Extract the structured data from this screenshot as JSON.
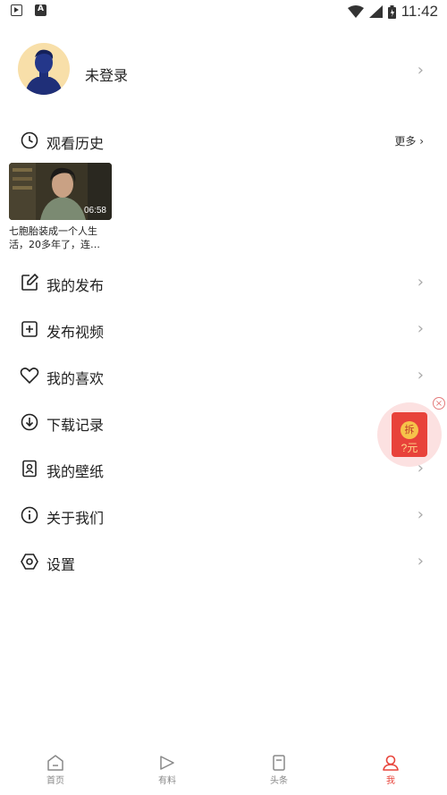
{
  "status_bar": {
    "time": "11:42"
  },
  "profile": {
    "name": "未登录"
  },
  "history": {
    "title": "观看历史",
    "more": "更多",
    "item": {
      "duration": "06:58",
      "title": "七胞胎装成一个人生活，20多年了，连…"
    }
  },
  "menu": [
    {
      "label": "我的发布",
      "icon": "edit-icon"
    },
    {
      "label": "发布视频",
      "icon": "plus-square-icon"
    },
    {
      "label": "我的喜欢",
      "icon": "heart-icon"
    },
    {
      "label": "下载记录",
      "icon": "download-icon"
    },
    {
      "label": "我的壁纸",
      "icon": "wallpaper-icon"
    },
    {
      "label": "关于我们",
      "icon": "info-icon"
    },
    {
      "label": "设置",
      "icon": "settings-icon"
    }
  ],
  "promo": {
    "coin": "拆",
    "amount": "?元"
  },
  "tabs": [
    {
      "label": "首页",
      "icon": "home-icon"
    },
    {
      "label": "有料",
      "icon": "play-icon"
    },
    {
      "label": "头条",
      "icon": "bookmark-icon"
    },
    {
      "label": "我",
      "icon": "user-icon"
    }
  ],
  "colors": {
    "accent": "#e8453c",
    "avatar_bg": "#f8dfa9",
    "promo_red": "#e8423a"
  }
}
